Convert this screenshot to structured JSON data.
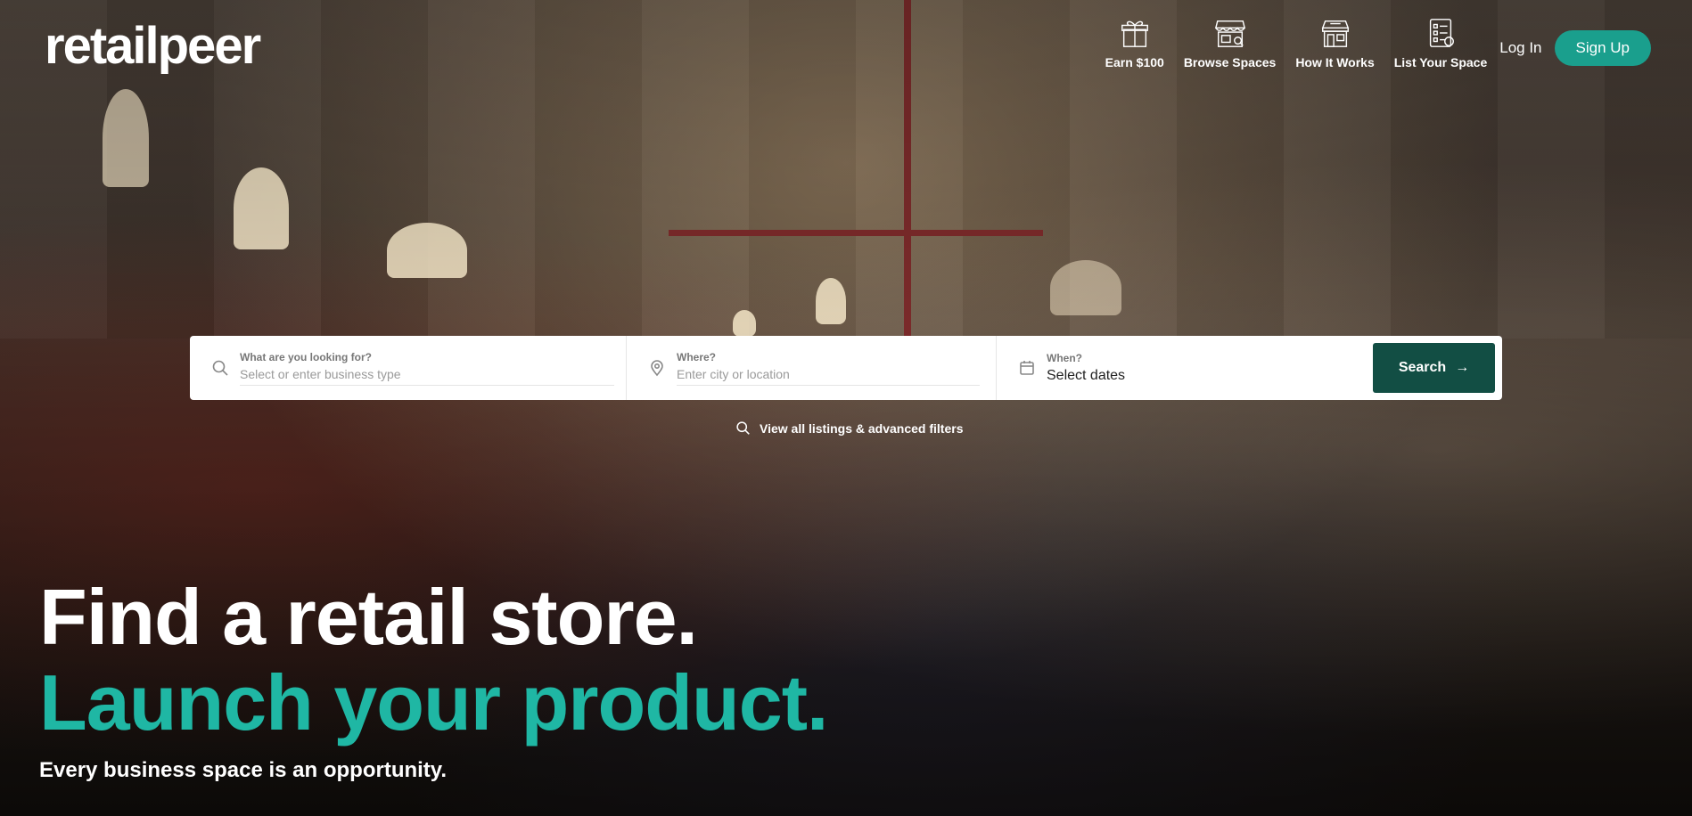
{
  "brand": {
    "logo": "retailpeer"
  },
  "nav": {
    "items": [
      {
        "label": "Earn $100",
        "icon": "gift-icon"
      },
      {
        "label": "Browse Spaces",
        "icon": "storefront-icon"
      },
      {
        "label": "How It Works",
        "icon": "shop-building-icon"
      },
      {
        "label": "List Your Space",
        "icon": "checklist-icon"
      }
    ],
    "login": "Log In",
    "signup": "Sign Up"
  },
  "search": {
    "what": {
      "label": "What are you looking for?",
      "placeholder": "Select or enter business type",
      "icon": "search-icon"
    },
    "where": {
      "label": "Where?",
      "placeholder": "Enter city or location",
      "icon": "location-pin-icon"
    },
    "when": {
      "label": "When?",
      "value": "Select dates",
      "icon": "calendar-icon"
    },
    "button": "Search",
    "all_listings": "View all listings & advanced filters"
  },
  "hero": {
    "line1": "Find a retail store.",
    "line2": "Launch your product.",
    "tagline": "Every business space is an opportunity."
  },
  "colors": {
    "accent": "#1a9f8d",
    "headline_accent": "#1fb7a4",
    "search_button": "#124e44"
  }
}
